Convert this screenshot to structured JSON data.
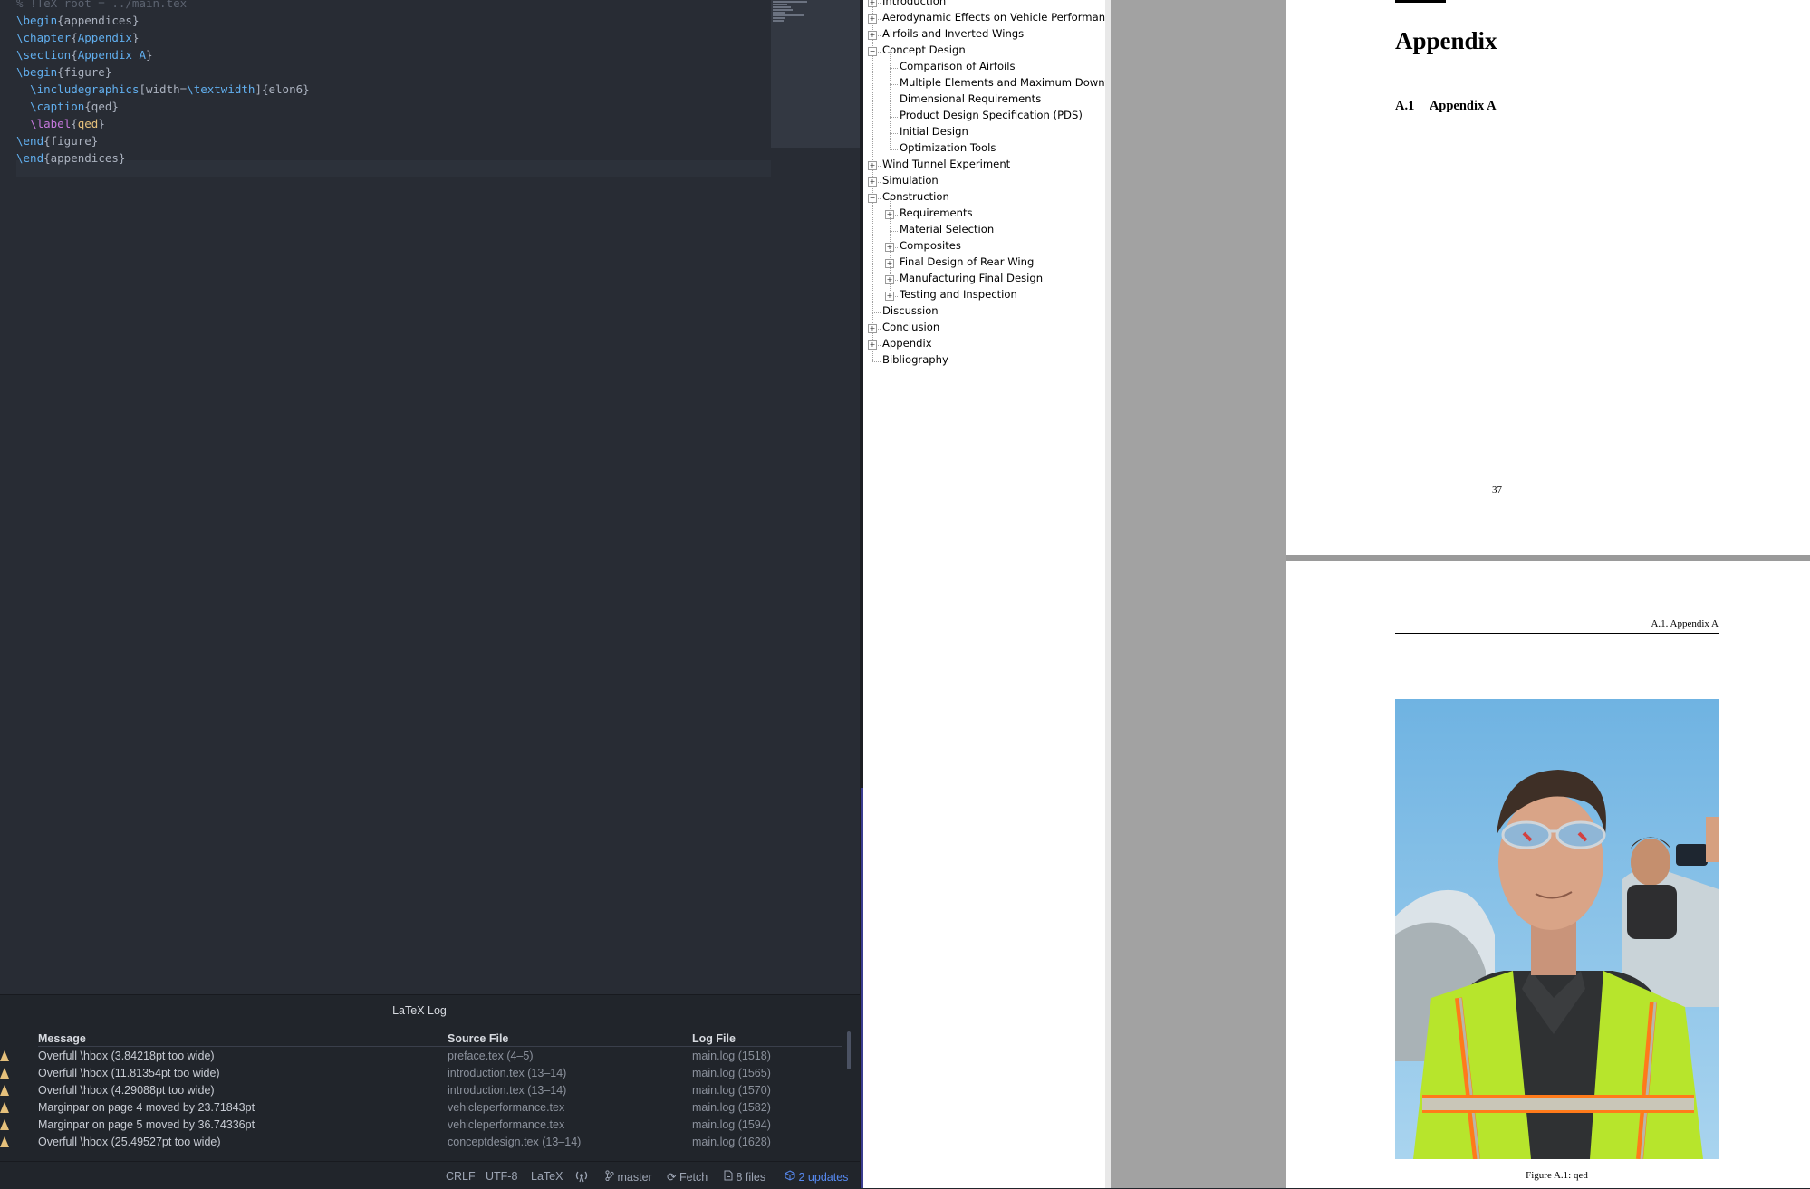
{
  "editor": {
    "lines": [
      {
        "cls": "comment",
        "text": "% !TeX root = ../main.tex"
      },
      {
        "parts": [
          [
            "cmd",
            "\\begin"
          ],
          [
            "arg",
            "{appendices}"
          ]
        ]
      },
      {
        "parts": [
          [
            "cmd",
            "\\chapter"
          ],
          [
            "arg",
            "{"
          ],
          [
            "argb",
            "Appendix"
          ],
          [
            "arg",
            "}"
          ]
        ]
      },
      {
        "parts": [
          [
            "cmd",
            "\\section"
          ],
          [
            "arg",
            "{"
          ],
          [
            "argb",
            "Appendix A"
          ],
          [
            "arg",
            "}"
          ]
        ]
      },
      {
        "parts": [
          [
            "cmd",
            "\\begin"
          ],
          [
            "arg",
            "{figure}"
          ]
        ]
      },
      {
        "parts": [
          [
            "arg",
            "  "
          ],
          [
            "cmd",
            "\\includegraphics"
          ],
          [
            "arg",
            "[width="
          ],
          [
            "cmd",
            "\\textwidth"
          ],
          [
            "arg",
            "]{elon6}"
          ]
        ]
      },
      {
        "parts": [
          [
            "arg",
            "  "
          ],
          [
            "cmd",
            "\\caption"
          ],
          [
            "arg",
            "{qed}"
          ]
        ]
      },
      {
        "parts": [
          [
            "arg",
            "  "
          ],
          [
            "lbl",
            "\\label"
          ],
          [
            "arg",
            "{"
          ],
          [
            "lbltxt",
            "qed"
          ],
          [
            "arg",
            "}"
          ]
        ]
      },
      {
        "parts": [
          [
            "cmd",
            "\\end"
          ],
          [
            "arg",
            "{figure}"
          ]
        ]
      },
      {
        "parts": [
          [
            "cmd",
            "\\end"
          ],
          [
            "arg",
            "{appendices}"
          ]
        ]
      }
    ]
  },
  "log": {
    "title": "LaTeX Log",
    "headers": {
      "message": "Message",
      "source": "Source File",
      "logfile": "Log File"
    },
    "rows": [
      {
        "message": "Overfull \\hbox (3.84218pt too wide)",
        "source": "preface.tex (4–5)",
        "logfile": "main.log (1518)"
      },
      {
        "message": "Overfull \\hbox (11.81354pt too wide)",
        "source": "introduction.tex (13–14)",
        "logfile": "main.log (1565)"
      },
      {
        "message": "Overfull \\hbox (4.29088pt too wide)",
        "source": "introduction.tex (13–14)",
        "logfile": "main.log (1570)"
      },
      {
        "message": "Marginpar on page 4 moved by 23.71843pt",
        "source": "vehicleperformance.tex",
        "logfile": "main.log (1582)"
      },
      {
        "message": "Marginpar on page 5 moved by 36.74336pt",
        "source": "vehicleperformance.tex",
        "logfile": "main.log (1594)"
      },
      {
        "message": "Overfull \\hbox (25.49527pt too wide)",
        "source": "conceptdesign.tex (13–14)",
        "logfile": "main.log (1628)"
      }
    ]
  },
  "status": {
    "eol": "CRLF",
    "encoding": "UTF-8",
    "grammar": "LaTeX",
    "branch": "master",
    "fetch": "Fetch",
    "files": "8 files",
    "updates": "2 updates"
  },
  "outline": [
    {
      "label": "Introduction",
      "level": 0,
      "box": "+"
    },
    {
      "label": "Aerodynamic Effects on Vehicle Performance",
      "level": 0,
      "box": "+"
    },
    {
      "label": "Airfoils and Inverted Wings",
      "level": 0,
      "box": "+"
    },
    {
      "label": "Concept Design",
      "level": 0,
      "box": "-"
    },
    {
      "label": "Comparison of Airfoils",
      "level": 1,
      "box": ""
    },
    {
      "label": "Multiple Elements and Maximum Downforce",
      "level": 1,
      "box": ""
    },
    {
      "label": "Dimensional Requirements",
      "level": 1,
      "box": ""
    },
    {
      "label": "Product Design Specification (PDS)",
      "level": 1,
      "box": ""
    },
    {
      "label": "Initial Design",
      "level": 1,
      "box": ""
    },
    {
      "label": "Optimization Tools",
      "level": 1,
      "box": ""
    },
    {
      "label": "Wind Tunnel Experiment",
      "level": 0,
      "box": "+"
    },
    {
      "label": "Simulation",
      "level": 0,
      "box": "+"
    },
    {
      "label": "Construction",
      "level": 0,
      "box": "-"
    },
    {
      "label": "Requirements",
      "level": 1,
      "box": "+"
    },
    {
      "label": "Material Selection",
      "level": 1,
      "box": ""
    },
    {
      "label": "Composites",
      "level": 1,
      "box": "+"
    },
    {
      "label": "Final Design of Rear Wing",
      "level": 1,
      "box": "+"
    },
    {
      "label": "Manufacturing Final Design",
      "level": 1,
      "box": "+"
    },
    {
      "label": "Testing and Inspection",
      "level": 1,
      "box": "+"
    },
    {
      "label": "Discussion",
      "level": 0,
      "box": ""
    },
    {
      "label": "Conclusion",
      "level": 0,
      "box": "+"
    },
    {
      "label": "Appendix",
      "level": 0,
      "box": "+"
    },
    {
      "label": "Bibliography",
      "level": 0,
      "box": ""
    }
  ],
  "pdf": {
    "page1": {
      "chapter": "Appendix",
      "section_num": "A.1",
      "section_title": "Appendix A",
      "page_number": "37"
    },
    "page2": {
      "header": "A.1.  Appendix A",
      "caption": "Figure A.1: qed"
    }
  }
}
